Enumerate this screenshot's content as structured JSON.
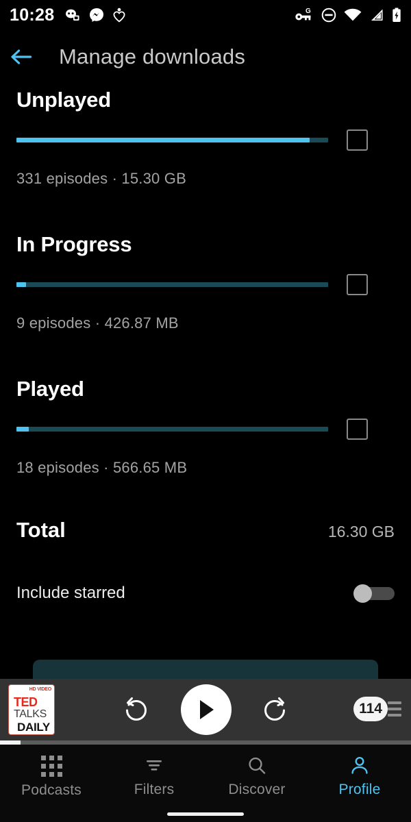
{
  "status_bar": {
    "time": "10:28",
    "left_icons": [
      "game-controller-icon",
      "messenger-icon",
      "heart-pin-icon"
    ],
    "right_icons": [
      "vpn-key-g-icon",
      "do-not-disturb-icon",
      "wifi-icon",
      "cellular-signal-icon",
      "battery-charging-icon"
    ]
  },
  "app_bar": {
    "back_icon": "arrow-left-icon",
    "title": "Manage downloads",
    "accent_color": "#4fc3f0",
    "title_color": "#c9c9c9"
  },
  "sections": [
    {
      "title": "Unplayed",
      "episodes_label": "331 episodes · 15.30 GB",
      "episodes": 331,
      "size": "15.30 GB",
      "bar_fill_percent": 94,
      "bar_track_percent": 100,
      "checkbox_checked": false
    },
    {
      "title": "In Progress",
      "episodes_label": "9 episodes · 426.87 MB",
      "episodes": 9,
      "size": "426.87 MB",
      "bar_fill_percent": 3,
      "bar_track_percent": 100,
      "checkbox_checked": false
    },
    {
      "title": "Played",
      "episodes_label": "18 episodes · 566.65 MB",
      "episodes": 18,
      "size": "566.65 MB",
      "bar_fill_percent": 4,
      "bar_track_percent": 100,
      "checkbox_checked": false
    }
  ],
  "total": {
    "label": "Total",
    "value": "16.30 GB"
  },
  "include_starred": {
    "label": "Include starred",
    "enabled": false
  },
  "colors": {
    "bar_fill": "#4fc3f0",
    "bar_track": "#1b4a57",
    "accent": "#4fc3f0",
    "peek_card": "#17343b",
    "player_bg": "#333333",
    "background": "#000000"
  },
  "player": {
    "artwork": {
      "hd_badge": "HD VIDEO",
      "line1": "TED",
      "line2": "TALKS",
      "line3": "DAILY"
    },
    "skip_back_icon": "skip-back-icon",
    "play_icon": "play-icon",
    "skip_forward_icon": "skip-forward-icon",
    "queue_count": "114",
    "queue_icon": "queue-list-icon",
    "progress_percent": 5
  },
  "bottom_nav": {
    "items": [
      {
        "label": "Podcasts",
        "icon": "grid-icon",
        "active": false
      },
      {
        "label": "Filters",
        "icon": "filter-icon",
        "active": false
      },
      {
        "label": "Discover",
        "icon": "search-icon",
        "active": false
      },
      {
        "label": "Profile",
        "icon": "person-icon",
        "active": true
      }
    ]
  }
}
